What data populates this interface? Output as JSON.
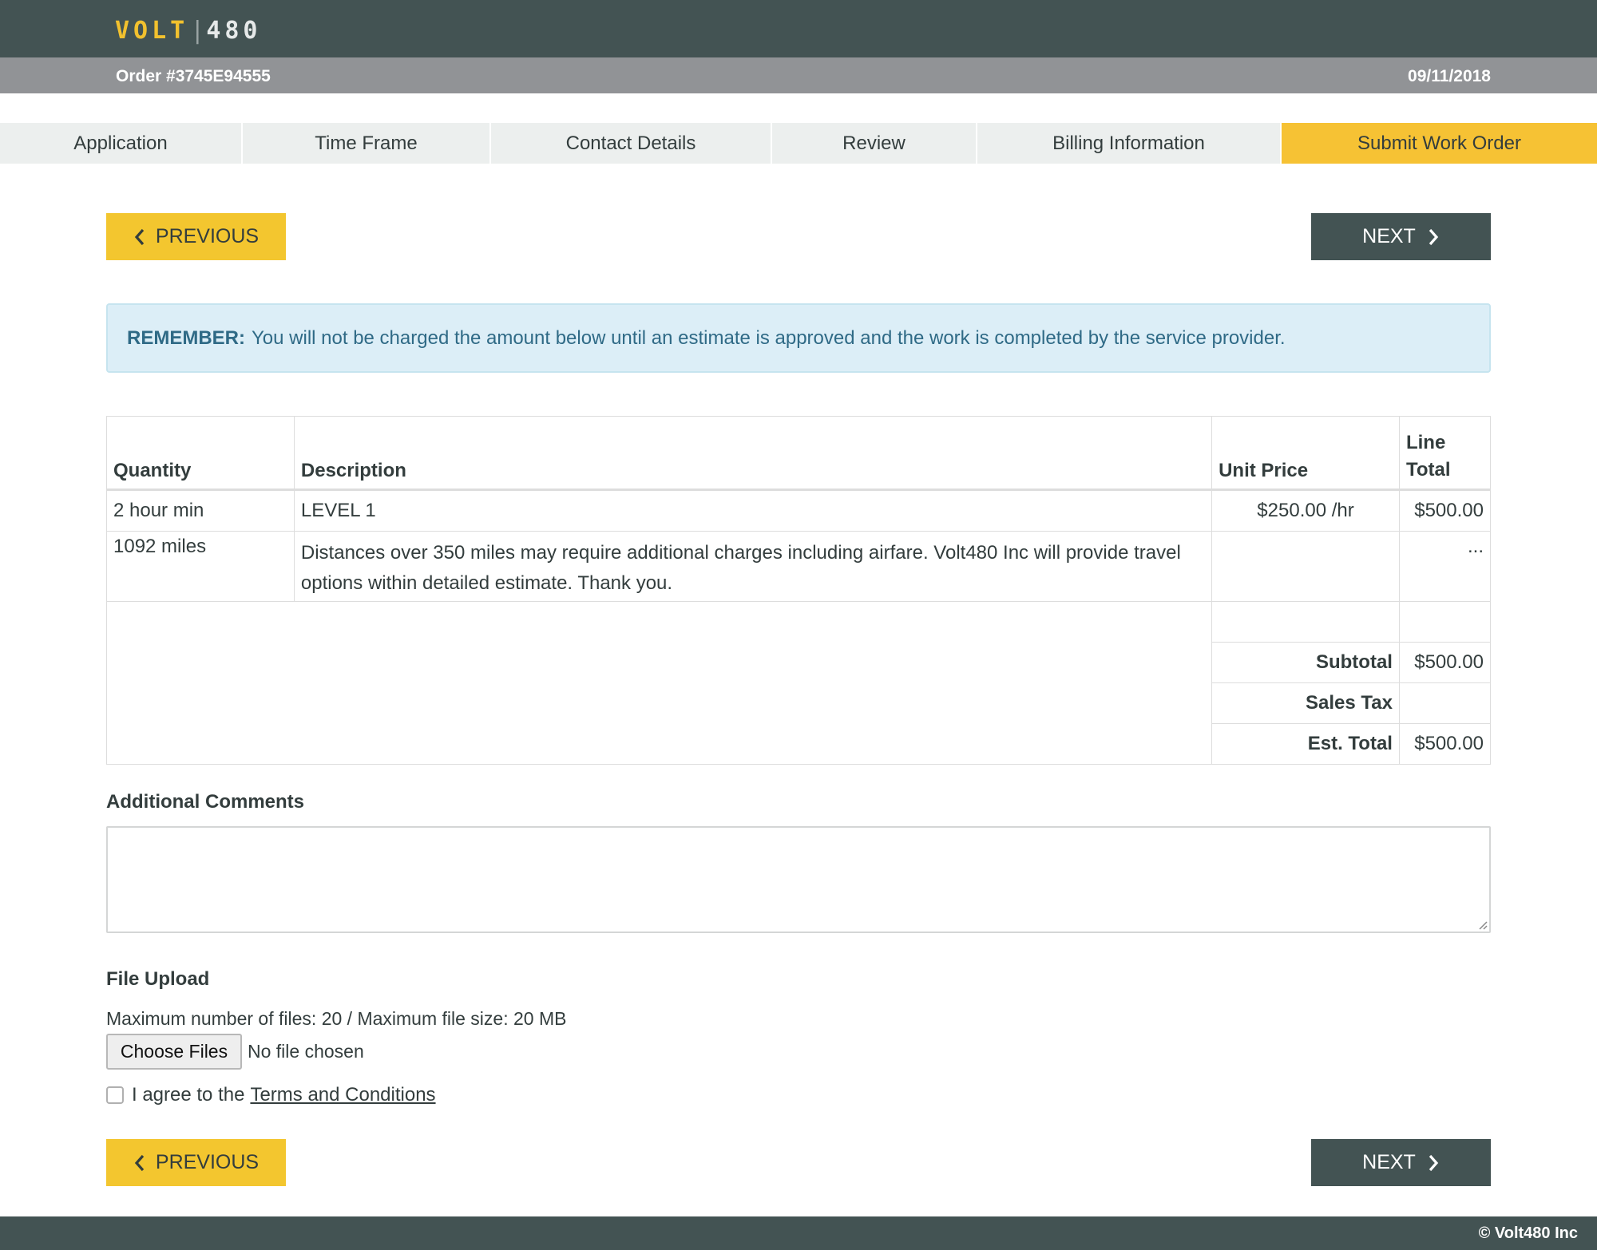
{
  "header": {
    "logo_left": "VOLT",
    "logo_sep": "|",
    "logo_right": "480",
    "order_label": "Order #3745E94555",
    "date": "09/11/2018"
  },
  "tabs": [
    {
      "label": "Application",
      "active": false
    },
    {
      "label": "Time Frame",
      "active": false
    },
    {
      "label": "Contact Details",
      "active": false
    },
    {
      "label": "Review",
      "active": false
    },
    {
      "label": "Billing Information",
      "active": false
    },
    {
      "label": "Submit Work Order",
      "active": true
    }
  ],
  "nav": {
    "previous_label": "PREVIOUS",
    "next_label": "NEXT"
  },
  "notice": {
    "strong": "REMEMBER:",
    "text": "You will not be charged the amount below until an estimate is approved and the work is completed by the service provider."
  },
  "table": {
    "headers": {
      "quantity": "Quantity",
      "description": "Description",
      "unit_price": "Unit Price",
      "line_total_1": "Line",
      "line_total_2": "Total"
    },
    "rows": [
      {
        "quantity": "2 hour min",
        "description": "LEVEL 1",
        "unit_price": "$250.00 /hr",
        "line_total": "$500.00"
      },
      {
        "quantity": "1092 miles",
        "description": "Distances over 350 miles may require additional charges including airfare. Volt480 Inc will provide travel options within detailed estimate. Thank you.",
        "unit_price": "",
        "line_total": "..."
      }
    ],
    "summary": {
      "subtotal_label": "Subtotal",
      "subtotal_value": "$500.00",
      "sales_tax_label": "Sales Tax",
      "sales_tax_value": "",
      "est_total_label": "Est. Total",
      "est_total_value": "$500.00"
    }
  },
  "comments": {
    "label": "Additional Comments",
    "value": ""
  },
  "upload": {
    "label": "File Upload",
    "hint": "Maximum number of files: 20 / Maximum file size: 20 MB",
    "button_label": "Choose Files",
    "status": "No file chosen"
  },
  "terms": {
    "prefix": "I agree to the",
    "link": "Terms and Conditions",
    "checked": false
  },
  "footer": {
    "copyright": "© Volt480 Inc"
  },
  "colors": {
    "header_bg": "#435353",
    "order_bar_bg": "#919396",
    "accent_yellow": "#f3c62f",
    "notice_bg": "#dceef7",
    "notice_text": "#2f6a86"
  }
}
